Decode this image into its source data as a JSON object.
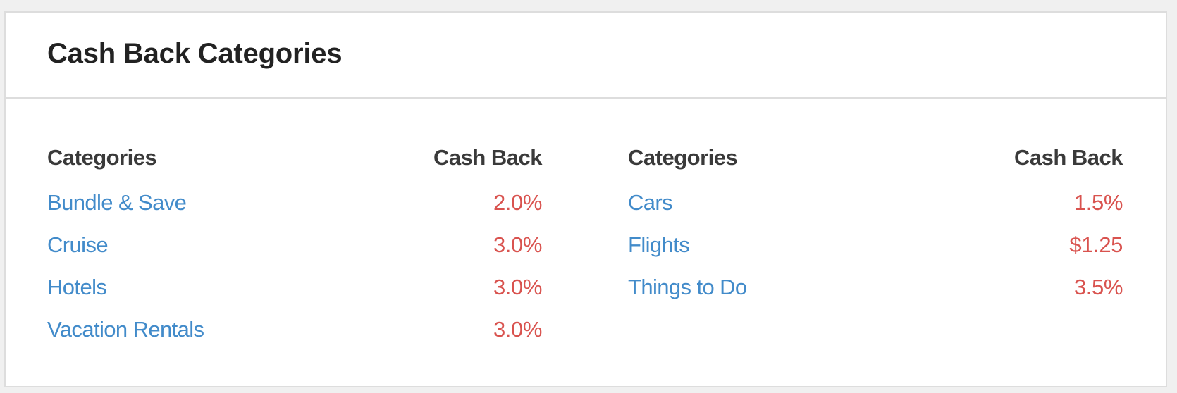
{
  "card": {
    "title": "Cash Back Categories"
  },
  "tables": [
    {
      "headers": {
        "category": "Categories",
        "cash_back": "Cash Back"
      },
      "rows": [
        {
          "category": "Bundle & Save",
          "cash_back": "2.0%"
        },
        {
          "category": "Cruise",
          "cash_back": "3.0%"
        },
        {
          "category": "Hotels",
          "cash_back": "3.0%"
        },
        {
          "category": "Vacation Rentals",
          "cash_back": "3.0%"
        }
      ]
    },
    {
      "headers": {
        "category": "Categories",
        "cash_back": "Cash Back"
      },
      "rows": [
        {
          "category": "Cars",
          "cash_back": "1.5%"
        },
        {
          "category": "Flights",
          "cash_back": "$1.25"
        },
        {
          "category": "Things to Do",
          "cash_back": "3.5%"
        }
      ]
    }
  ],
  "colors": {
    "link": "#428bca",
    "value": "#d9534f",
    "heading": "#3a3a3a",
    "title": "#222222",
    "border": "#dddddd",
    "page_background": "#f0f0f0"
  }
}
